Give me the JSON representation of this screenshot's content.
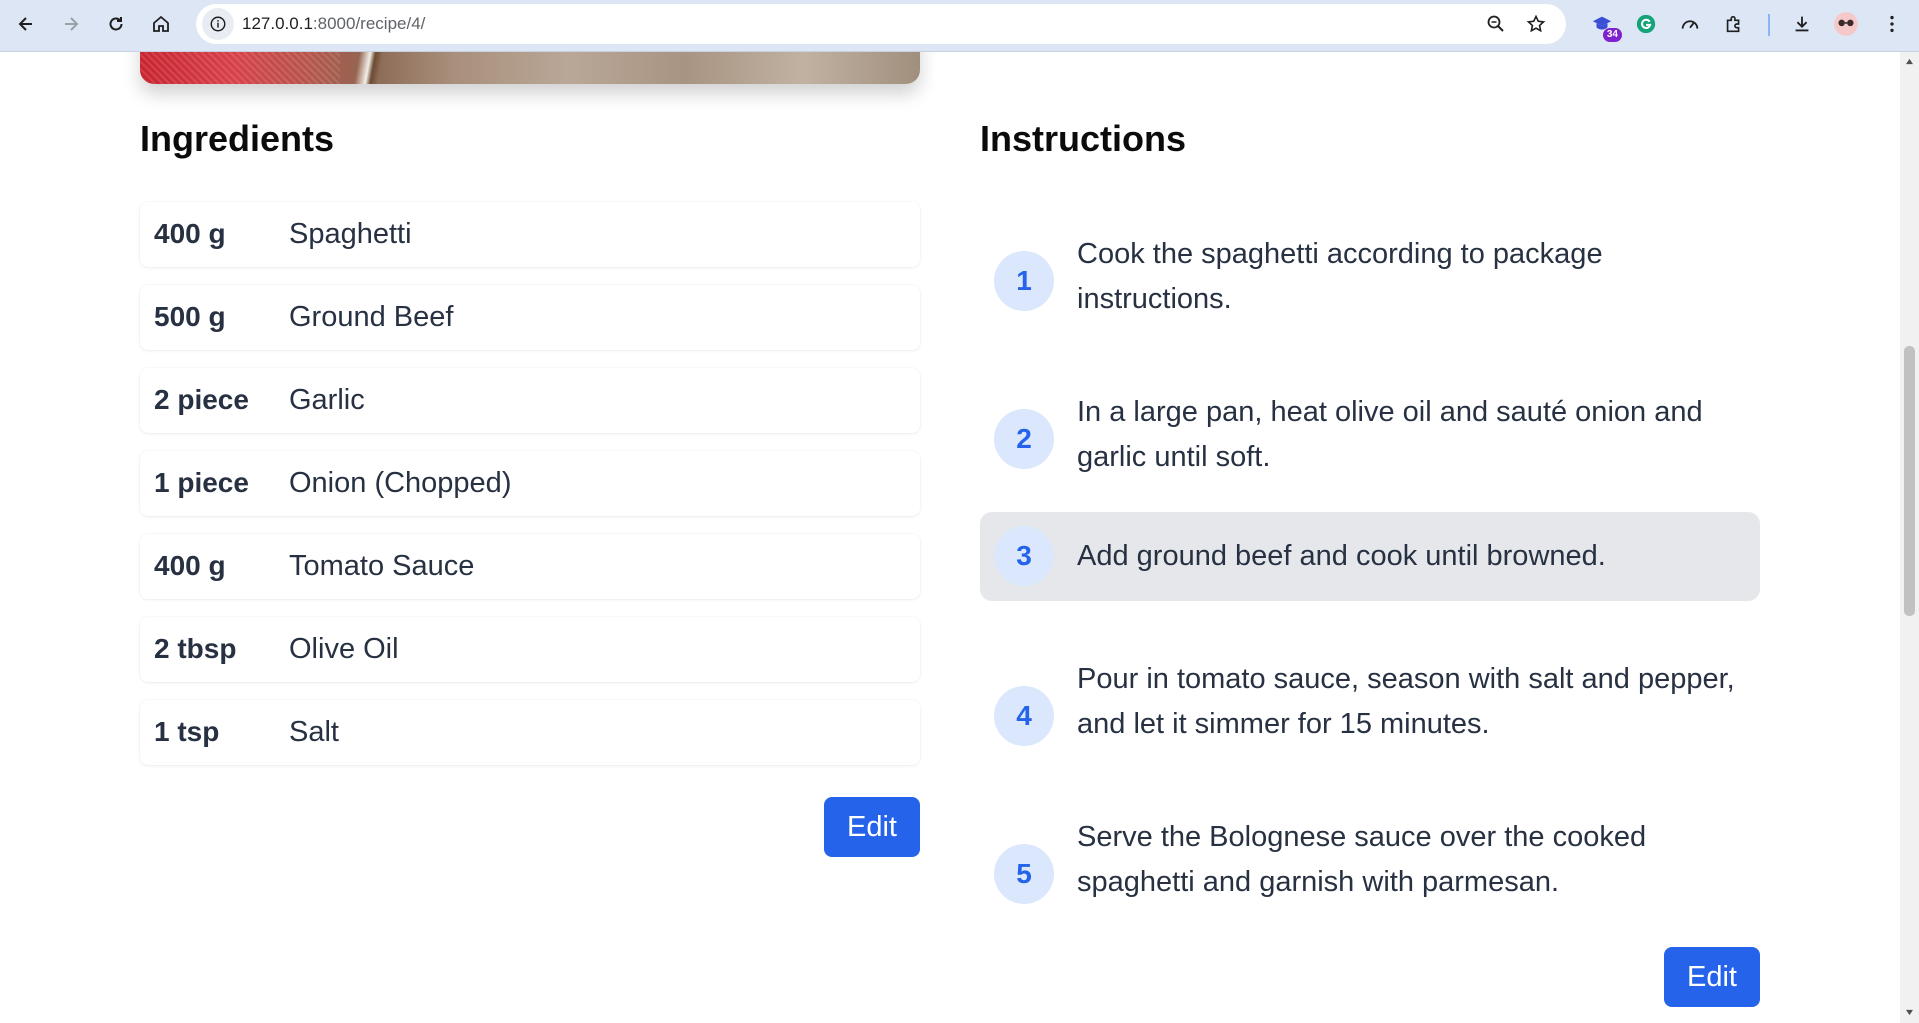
{
  "browser": {
    "url_host": "127.0.0.1",
    "url_path": ":8000/recipe/4/",
    "extension_badge": "34"
  },
  "ingredients": {
    "title": "Ingredients",
    "items": [
      {
        "qty": "400 g",
        "name": "Spaghetti"
      },
      {
        "qty": "500 g",
        "name": "Ground Beef"
      },
      {
        "qty": "2 piece",
        "name": "Garlic"
      },
      {
        "qty": "1 piece",
        "name": "Onion (Chopped)"
      },
      {
        "qty": "400 g",
        "name": "Tomato Sauce"
      },
      {
        "qty": "2 tbsp",
        "name": "Olive Oil"
      },
      {
        "qty": "1 tsp",
        "name": "Salt"
      }
    ],
    "edit_label": "Edit"
  },
  "instructions": {
    "title": "Instructions",
    "steps": [
      {
        "num": "1",
        "text": "Cook the spaghetti according to package instructions."
      },
      {
        "num": "2",
        "text": "In a large pan, heat olive oil and sauté onion and garlic until soft."
      },
      {
        "num": "3",
        "text": "Add ground beef and cook until browned."
      },
      {
        "num": "4",
        "text": "Pour in tomato sauce, season with salt and pepper, and let it simmer for 15 minutes."
      },
      {
        "num": "5",
        "text": "Serve the Bolognese sauce over the cooked spaghetti and garnish with parmesan."
      }
    ],
    "edit_label": "Edit"
  },
  "colors": {
    "accent": "#2563eb",
    "step_circle_bg": "#dbe7fc",
    "active_step_bg": "#e5e7eb"
  }
}
